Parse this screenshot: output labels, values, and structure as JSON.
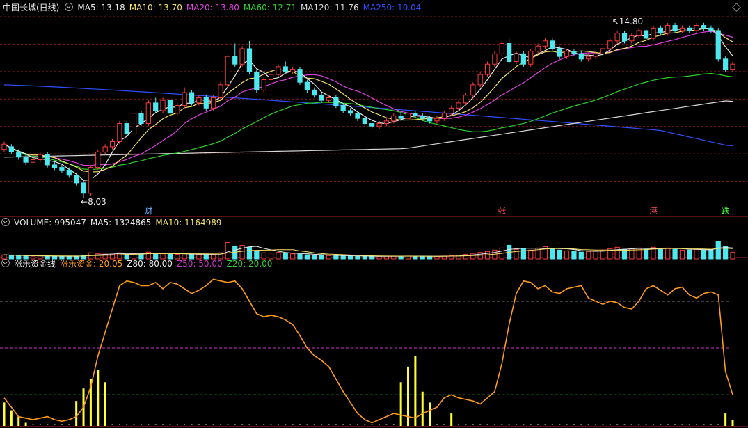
{
  "app": {
    "title": "中国长城(日线)"
  },
  "colors": {
    "up": "#ff3b3b",
    "down": "#4de8f0",
    "ma5": "#e8e8e8",
    "ma10": "#f5e16a",
    "ma20": "#e040e0",
    "ma60": "#28d228",
    "ma120": "#d8d8d8",
    "ma250": "#3050ff",
    "zlzj": "#ff9a1e",
    "z80": "#e8e8e8",
    "z50": "#cc33cc",
    "z20": "#33cc33",
    "bars": "#ffff33",
    "grid": "#8a1a1a"
  },
  "price_header": {
    "ma5": "MA5: 13.18",
    "ma10": "MA10: 13.70",
    "ma20": "MA20: 13.80",
    "ma60": "MA60: 12.71",
    "ma120": "MA120: 11.76",
    "ma250": "MA250: 10.04"
  },
  "price_annotations": {
    "high": "14.80",
    "low": "8.03"
  },
  "events": [
    {
      "label": "财",
      "color": "#6aa8ff",
      "idx": 20
    },
    {
      "label": "张",
      "color": "#ff5050",
      "idx": 69
    },
    {
      "label": "港",
      "color": "#ff5050",
      "idx": 90
    },
    {
      "label": "跌",
      "color": "#40ff40",
      "idx": 100
    }
  ],
  "volume_header": {
    "name": "VOLUME: 995047",
    "ma5": "MA5: 1324865",
    "ma10": "MA10: 1164989"
  },
  "ind_header": {
    "name": "涨乐资金线",
    "value": "涨乐资金: 20.05",
    "z80": "Z80: 80.00",
    "z50": "Z50: 50.00",
    "z20": "Z20: 20.00"
  },
  "chart_data": [
    {
      "type": "candlestick",
      "title": "中国长城(日线)",
      "ylim": [
        7.6,
        15.2
      ],
      "candles": [
        [
          9.9,
          10.1,
          10.2,
          9.8
        ],
        [
          10.0,
          9.8,
          10.1,
          9.7
        ],
        [
          9.8,
          9.6,
          9.9,
          9.5
        ],
        [
          9.6,
          9.4,
          9.7,
          9.3
        ],
        [
          9.4,
          9.5,
          9.6,
          9.3
        ],
        [
          9.5,
          9.7,
          9.8,
          9.4
        ],
        [
          9.7,
          9.3,
          9.8,
          9.2
        ],
        [
          9.3,
          9.2,
          9.4,
          9.1
        ],
        [
          9.2,
          9.1,
          9.3,
          9.0
        ],
        [
          9.1,
          8.9,
          9.2,
          8.8
        ],
        [
          8.9,
          8.6,
          9.0,
          8.5
        ],
        [
          8.6,
          8.2,
          8.7,
          8.03
        ],
        [
          8.2,
          9.2,
          9.3,
          8.1
        ],
        [
          9.2,
          9.8,
          9.9,
          9.1
        ],
        [
          9.8,
          10.0,
          10.1,
          9.7
        ],
        [
          10.0,
          10.2,
          10.3,
          9.9
        ],
        [
          10.2,
          10.9,
          11.0,
          10.1
        ],
        [
          10.9,
          10.5,
          11.0,
          10.4
        ],
        [
          10.5,
          11.3,
          11.4,
          10.4
        ],
        [
          11.3,
          10.9,
          11.4,
          10.8
        ],
        [
          10.9,
          11.7,
          11.8,
          10.8
        ],
        [
          11.7,
          11.4,
          11.9,
          11.3
        ],
        [
          11.4,
          11.8,
          11.9,
          11.3
        ],
        [
          11.8,
          11.3,
          11.9,
          11.2
        ],
        [
          11.3,
          11.6,
          11.7,
          11.2
        ],
        [
          11.6,
          12.1,
          12.3,
          11.5
        ],
        [
          12.1,
          11.7,
          12.2,
          11.6
        ],
        [
          11.7,
          11.9,
          12.0,
          11.6
        ],
        [
          11.9,
          11.5,
          12.0,
          11.4
        ],
        [
          11.5,
          11.9,
          12.0,
          11.4
        ],
        [
          11.9,
          12.4,
          12.5,
          11.8
        ],
        [
          12.4,
          13.5,
          13.6,
          12.3
        ],
        [
          13.5,
          13.2,
          14.0,
          13.1
        ],
        [
          13.2,
          13.8,
          13.9,
          13.1
        ],
        [
          13.8,
          12.9,
          14.1,
          12.8
        ],
        [
          12.9,
          12.2,
          13.0,
          12.1
        ],
        [
          12.2,
          12.6,
          12.7,
          12.1
        ],
        [
          12.6,
          12.8,
          12.9,
          12.5
        ],
        [
          12.8,
          13.1,
          13.2,
          12.7
        ],
        [
          13.1,
          12.9,
          13.3,
          12.8
        ],
        [
          12.9,
          13.0,
          13.1,
          12.8
        ],
        [
          13.0,
          12.5,
          13.1,
          12.4
        ],
        [
          12.5,
          12.2,
          12.6,
          12.1
        ],
        [
          12.2,
          12.0,
          12.3,
          11.9
        ],
        [
          12.0,
          11.8,
          12.1,
          11.7
        ],
        [
          11.8,
          11.9,
          12.0,
          11.7
        ],
        [
          11.9,
          11.6,
          12.0,
          11.5
        ],
        [
          11.6,
          11.4,
          11.7,
          11.3
        ],
        [
          11.4,
          11.3,
          11.5,
          11.2
        ],
        [
          11.3,
          11.1,
          11.4,
          11.0
        ],
        [
          11.1,
          10.9,
          11.2,
          10.8
        ],
        [
          10.9,
          10.8,
          11.0,
          10.7
        ],
        [
          10.8,
          10.9,
          11.0,
          10.7
        ],
        [
          10.9,
          11.0,
          11.1,
          10.8
        ],
        [
          11.0,
          11.2,
          11.3,
          10.9
        ],
        [
          11.2,
          11.1,
          11.3,
          11.0
        ],
        [
          11.1,
          11.3,
          11.4,
          11.0
        ],
        [
          11.3,
          11.2,
          11.4,
          11.1
        ],
        [
          11.2,
          11.1,
          11.3,
          11.0
        ],
        [
          11.1,
          11.0,
          11.2,
          10.9
        ],
        [
          11.0,
          11.1,
          11.2,
          10.9
        ],
        [
          11.1,
          11.3,
          11.4,
          11.0
        ],
        [
          11.3,
          11.5,
          11.6,
          11.2
        ],
        [
          11.5,
          11.7,
          11.8,
          11.4
        ],
        [
          11.7,
          12.0,
          12.1,
          11.6
        ],
        [
          12.0,
          12.4,
          12.5,
          11.9
        ],
        [
          12.4,
          12.8,
          12.9,
          12.3
        ],
        [
          12.8,
          13.2,
          13.3,
          12.7
        ],
        [
          13.2,
          13.6,
          13.7,
          13.1
        ],
        [
          13.6,
          14.0,
          14.1,
          13.5
        ],
        [
          14.0,
          13.3,
          14.2,
          13.2
        ],
        [
          13.3,
          13.6,
          13.7,
          13.2
        ],
        [
          13.6,
          13.2,
          13.7,
          13.1
        ],
        [
          13.2,
          13.7,
          13.8,
          13.1
        ],
        [
          13.7,
          13.9,
          14.0,
          13.6
        ],
        [
          13.9,
          14.1,
          14.2,
          13.8
        ],
        [
          14.1,
          13.8,
          14.2,
          13.7
        ],
        [
          13.8,
          13.5,
          13.9,
          13.4
        ],
        [
          13.5,
          13.7,
          13.8,
          13.4
        ],
        [
          13.7,
          13.6,
          13.8,
          13.5
        ],
        [
          13.6,
          13.4,
          13.7,
          13.3
        ],
        [
          13.4,
          13.5,
          13.6,
          13.3
        ],
        [
          13.5,
          13.6,
          13.7,
          13.4
        ],
        [
          13.6,
          13.8,
          13.9,
          13.5
        ],
        [
          13.8,
          14.1,
          14.2,
          13.7
        ],
        [
          14.1,
          14.4,
          14.5,
          14.0
        ],
        [
          14.4,
          14.1,
          14.5,
          14.0
        ],
        [
          14.1,
          14.3,
          14.4,
          14.0
        ],
        [
          14.3,
          14.5,
          14.6,
          14.2
        ],
        [
          14.5,
          14.2,
          14.6,
          14.1
        ],
        [
          14.2,
          14.6,
          14.7,
          14.1
        ],
        [
          14.6,
          14.4,
          14.7,
          14.3
        ],
        [
          14.4,
          14.7,
          14.8,
          14.3
        ],
        [
          14.7,
          14.5,
          14.8,
          14.4
        ],
        [
          14.5,
          14.6,
          14.7,
          14.4
        ],
        [
          14.6,
          14.5,
          14.7,
          14.4
        ],
        [
          14.5,
          14.7,
          14.8,
          14.4
        ],
        [
          14.7,
          14.6,
          14.8,
          14.5
        ],
        [
          14.6,
          14.5,
          14.7,
          14.4
        ],
        [
          14.5,
          13.4,
          14.6,
          13.3
        ],
        [
          13.4,
          13.0,
          13.5,
          12.9
        ],
        [
          13.0,
          13.2,
          13.3,
          12.9
        ]
      ],
      "moving_averages": [
        {
          "name": "MA5",
          "value": 13.18
        },
        {
          "name": "MA10",
          "value": 13.7
        },
        {
          "name": "MA20",
          "value": 13.8
        },
        {
          "name": "MA60",
          "value": 12.71
        },
        {
          "name": "MA120",
          "value": 11.76
        },
        {
          "name": "MA250",
          "value": 10.04
        }
      ]
    },
    {
      "type": "bar",
      "title": "VOLUME",
      "last": 995047,
      "ma5": 1324865,
      "ma10": 1164989,
      "ylim": [
        0,
        4500000
      ],
      "values": [
        600000,
        500000,
        450000,
        420000,
        400000,
        450000,
        400000,
        380000,
        360000,
        380000,
        420000,
        550000,
        900000,
        750000,
        700000,
        680000,
        900000,
        700000,
        800000,
        700000,
        1000000,
        800000,
        750000,
        700000,
        650000,
        800000,
        700000,
        650000,
        600000,
        650000,
        900000,
        2400000,
        1900000,
        2000000,
        1700000,
        1200000,
        900000,
        850000,
        950000,
        800000,
        750000,
        700000,
        600000,
        550000,
        500000,
        480000,
        450000,
        430000,
        420000,
        400000,
        380000,
        370000,
        380000,
        400000,
        420000,
        400000,
        420000,
        400000,
        380000,
        370000,
        380000,
        420000,
        480000,
        550000,
        650000,
        800000,
        950000,
        1100000,
        1300000,
        1600000,
        2000000,
        1400000,
        1500000,
        1300000,
        1600000,
        1800000,
        1500000,
        1300000,
        1200000,
        1100000,
        1000000,
        1100000,
        1200000,
        1300000,
        1500000,
        1700000,
        1400000,
        1500000,
        1600000,
        1400000,
        1700000,
        1500000,
        1600000,
        1400000,
        1300000,
        1300000,
        1400000,
        1350000,
        1300000,
        2600000,
        1800000,
        995047
      ]
    },
    {
      "type": "line",
      "title": "涨乐资金线",
      "ylim": [
        0,
        100
      ],
      "reference_lines": [
        {
          "name": "Z80",
          "value": 80
        },
        {
          "name": "Z50",
          "value": 50
        },
        {
          "name": "Z20",
          "value": 20
        }
      ],
      "series": [
        {
          "name": "涨乐资金",
          "values": [
            18,
            12,
            6,
            5,
            4,
            5,
            6,
            4,
            3,
            4,
            6,
            12,
            25,
            45,
            60,
            75,
            90,
            93,
            92,
            90,
            90,
            92,
            88,
            92,
            91,
            88,
            85,
            87,
            90,
            94,
            93,
            92,
            93,
            88,
            80,
            72,
            70,
            71,
            70,
            68,
            65,
            58,
            50,
            45,
            42,
            38,
            30,
            22,
            15,
            8,
            4,
            2,
            4,
            6,
            8,
            7,
            6,
            5,
            8,
            10,
            12,
            18,
            20,
            18,
            17,
            16,
            14,
            18,
            22,
            40,
            65,
            85,
            93,
            92,
            88,
            90,
            86,
            85,
            88,
            89,
            90,
            82,
            80,
            78,
            80,
            79,
            76,
            75,
            80,
            88,
            90,
            87,
            84,
            88,
            89,
            84,
            82,
            85,
            86,
            84,
            35,
            20.05
          ]
        }
      ],
      "histogram": {
        "name": "bars",
        "values": [
          15,
          10,
          6,
          2,
          0,
          0,
          0,
          0,
          0,
          0,
          16,
          24,
          30,
          36,
          28,
          0,
          0,
          0,
          0,
          0,
          0,
          0,
          0,
          0,
          0,
          0,
          0,
          0,
          0,
          0,
          0,
          0,
          0,
          0,
          0,
          0,
          0,
          0,
          0,
          0,
          0,
          0,
          0,
          0,
          0,
          0,
          0,
          0,
          0,
          0,
          0,
          0,
          0,
          0,
          0,
          28,
          38,
          45,
          22,
          15,
          0,
          0,
          8,
          0,
          0,
          0,
          0,
          0,
          0,
          0,
          0,
          0,
          0,
          0,
          0,
          0,
          0,
          0,
          0,
          0,
          0,
          0,
          0,
          0,
          0,
          0,
          0,
          0,
          0,
          0,
          0,
          0,
          0,
          0,
          0,
          0,
          0,
          0,
          0,
          0,
          8,
          4
        ]
      }
    }
  ]
}
